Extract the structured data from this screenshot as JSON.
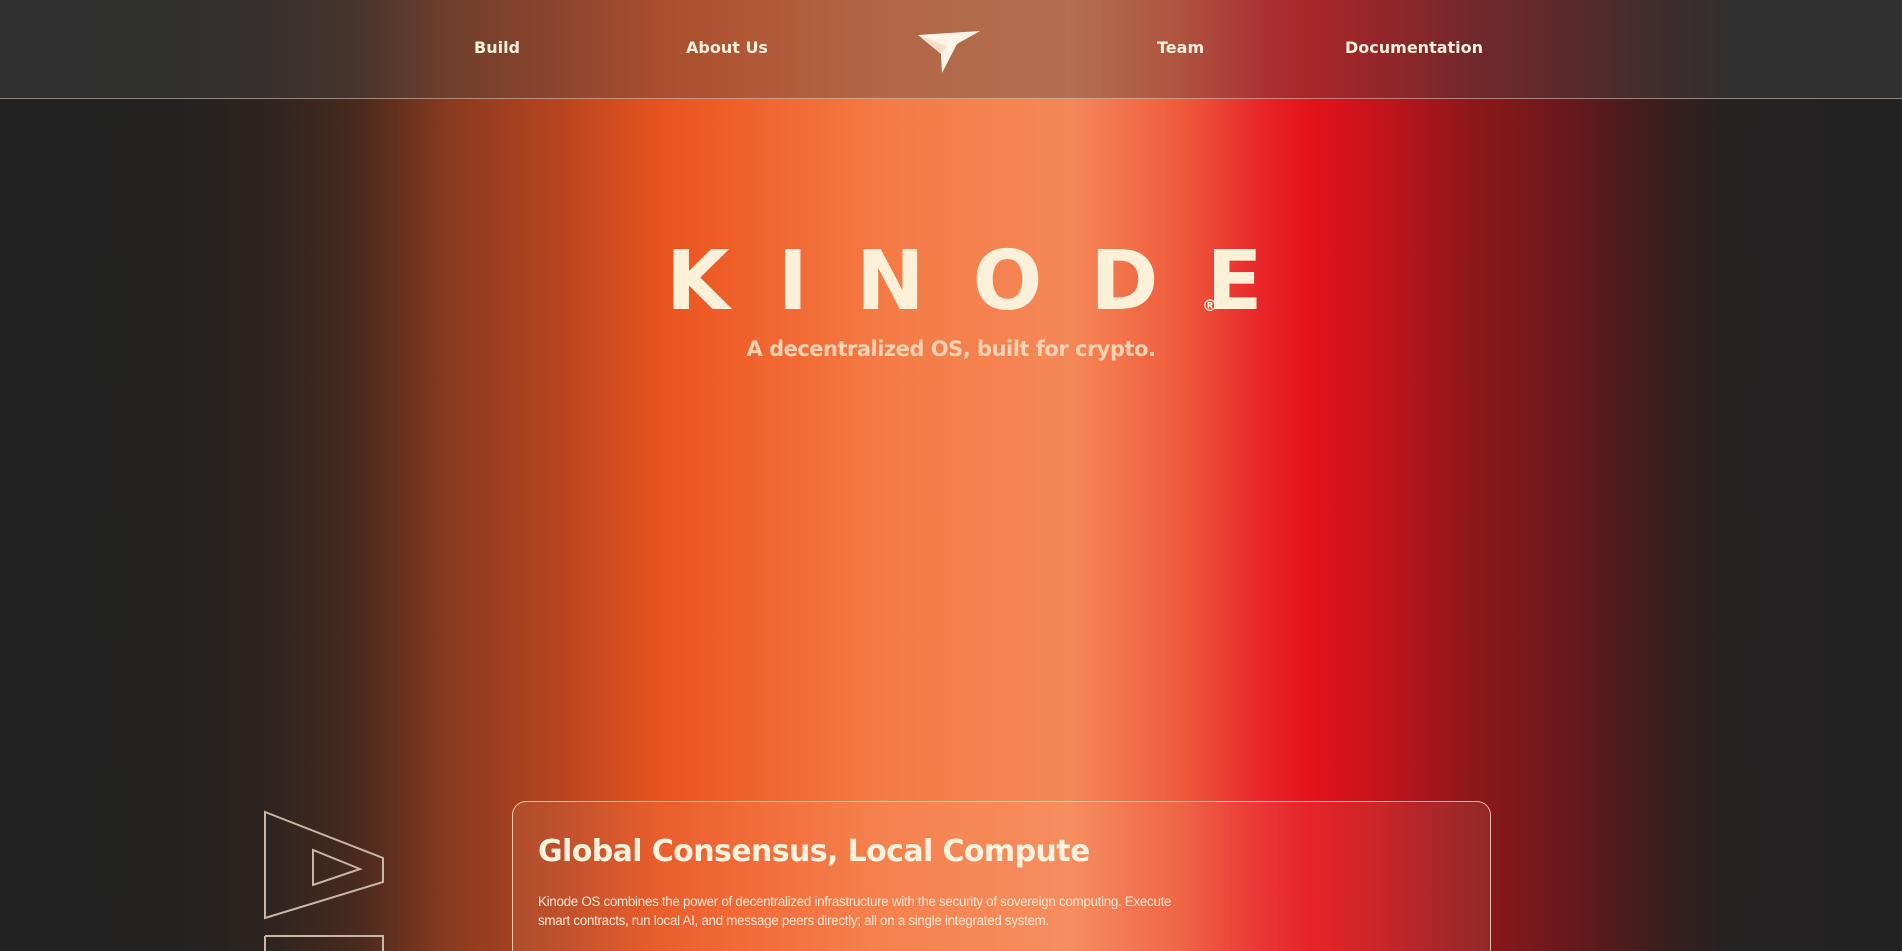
{
  "nav": {
    "build": "Build",
    "about": "About Us",
    "team": "Team",
    "documentation": "Documentation",
    "logo_icon": "bird-logo-icon"
  },
  "hero": {
    "title": "KINODE",
    "registered_mark": "®",
    "subtitle": "A decentralized OS, built for crypto."
  },
  "background_text": {
    "letters": "AI",
    "style": "outline"
  },
  "feature_card": {
    "title": "Global Consensus, Local Compute",
    "body": "Kinode OS combines the power of decentralized infrastructure with the security of sovereign computing. Execute smart contracts, run local AI, and message peers directly; all on a single integrated system."
  },
  "colors": {
    "background": "#222222",
    "orange": "#f0602b",
    "peach": "#f58858",
    "red": "#e41219",
    "cream": "#fdf0d8"
  }
}
